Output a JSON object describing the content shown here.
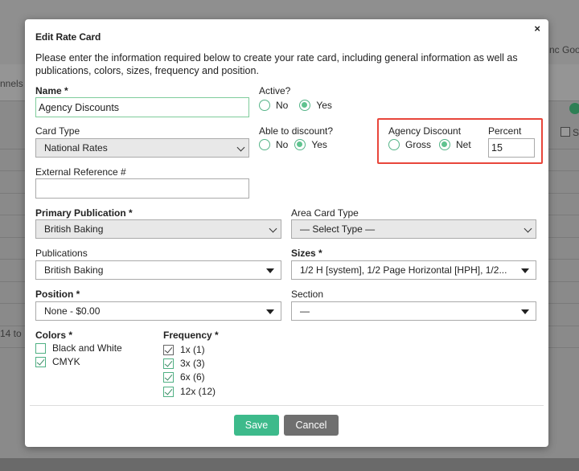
{
  "background": {
    "left_text_1": "nnels",
    "left_text_2": "14 to",
    "right_text_1": "nc Goog",
    "right_text_2": "SI"
  },
  "modal": {
    "title": "Edit Rate Card",
    "close_label": "×",
    "intro": "Please enter the information required below to create your rate card, including general information as well as publications, colors, sizes, frequency and position.",
    "name": {
      "label": "Name *",
      "value": "Agency Discounts"
    },
    "active": {
      "label": "Active?",
      "options": [
        "No",
        "Yes"
      ],
      "selected": "Yes"
    },
    "card_type": {
      "label": "Card Type",
      "value": "National Rates"
    },
    "able_to_discount": {
      "label": "Able to discount?",
      "options": [
        "No",
        "Yes"
      ],
      "selected": "Yes"
    },
    "agency_discount": {
      "label": "Agency Discount",
      "options": [
        "Gross",
        "Net"
      ],
      "selected": "Net",
      "highlight_color": "#e8463b"
    },
    "percent": {
      "label": "Percent",
      "value": "15"
    },
    "external_reference": {
      "label": "External Reference #",
      "value": ""
    },
    "primary_publication": {
      "label": "Primary Publication *",
      "value": "British Baking"
    },
    "area_card_type": {
      "label": "Area Card Type",
      "value": "— Select Type —"
    },
    "publications": {
      "label": "Publications",
      "value": "British Baking"
    },
    "sizes": {
      "label": "Sizes *",
      "value": "1/2 H [system], 1/2 Page Horizontal [HPH], 1/2..."
    },
    "position": {
      "label": "Position *",
      "value": "None - $0.00"
    },
    "section": {
      "label": "Section",
      "value": "—"
    },
    "colors": {
      "label": "Colors *",
      "items": [
        {
          "label": "Black and White",
          "checked": false
        },
        {
          "label": "CMYK",
          "checked": true
        }
      ]
    },
    "frequency": {
      "label": "Frequency *",
      "items": [
        {
          "label": "1x (1)",
          "checked": true
        },
        {
          "label": "3x (3)",
          "checked": true
        },
        {
          "label": "6x (6)",
          "checked": true
        },
        {
          "label": "12x (12)",
          "checked": true
        }
      ]
    },
    "buttons": {
      "save": "Save",
      "cancel": "Cancel"
    },
    "accent_color": "#3dba8b"
  }
}
